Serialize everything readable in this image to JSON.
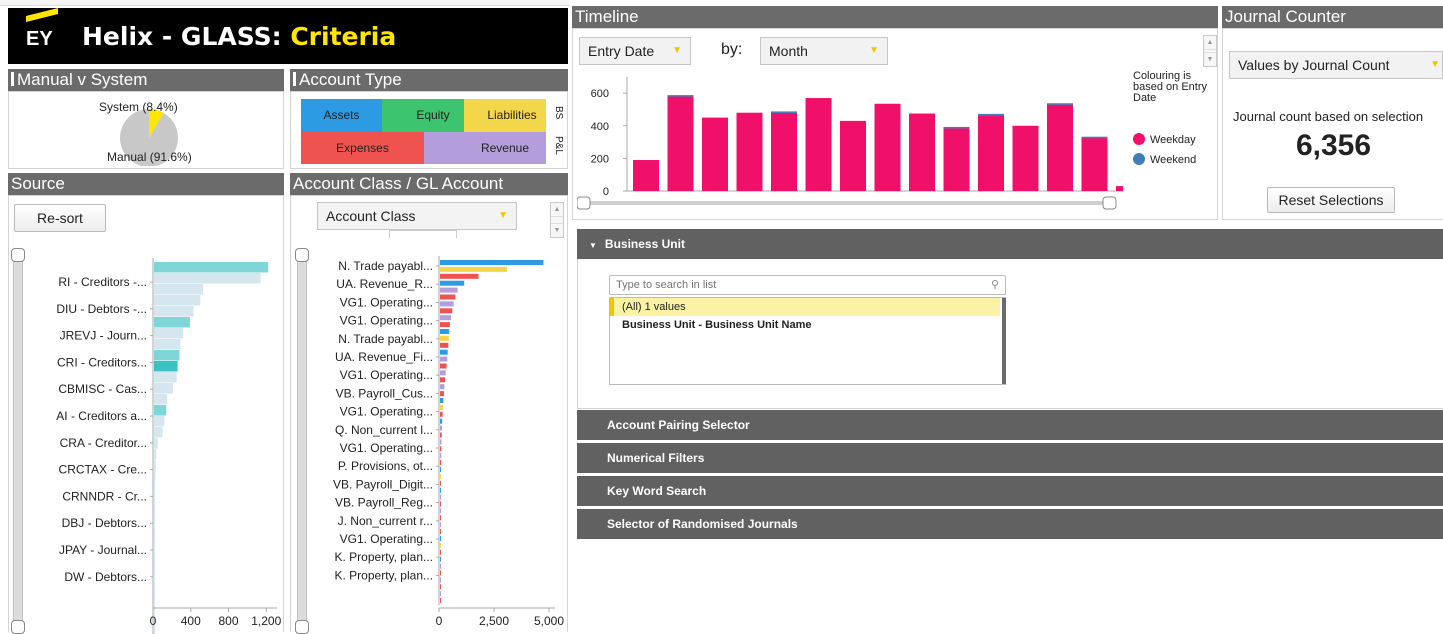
{
  "banner": {
    "brand": "EY",
    "title_prefix": "Helix - GLASS:",
    "title_highlight": "Criteria"
  },
  "manual_v_system": {
    "header": "Manual v System",
    "system_label": "System (8.4%)",
    "manual_label": "Manual (91.6%)",
    "slices": [
      {
        "name": "Manual",
        "value": 91.6,
        "color": "#c8c8c8"
      },
      {
        "name": "System",
        "value": 8.4,
        "color": "#ffe600"
      }
    ]
  },
  "account_type": {
    "header": "Account Type",
    "tiles": [
      {
        "label": "Assets",
        "color": "#2c9be4"
      },
      {
        "label": "Equity",
        "color": "#3dc46f"
      },
      {
        "label": "Liabilities",
        "color": "#f4d64a"
      },
      {
        "label": "Expenses",
        "color": "#ef5350"
      },
      {
        "label": "Revenue",
        "color": "#b39ddb"
      }
    ],
    "side_labels": [
      "BS",
      "P&L"
    ]
  },
  "source": {
    "header": "Source",
    "resort_label": "Re-sort",
    "chart_data": {
      "type": "bar",
      "orientation": "horizontal",
      "categories": [
        "RI - Creditors -...",
        "DIU - Debtors -...",
        "JREVJ - Journ...",
        "CRI - Creditors...",
        "CBMISC - Cas...",
        "AI - Creditors a...",
        "CRA - Creditor...",
        "CRCTAX - Cre...",
        "CRNNDR - Cr...",
        "DBJ - Debtors...",
        "JPAY - Journal...",
        "DW - Debtors..."
      ],
      "values": [
        1210,
        1130,
        520,
        490,
        420,
        380,
        310,
        280,
        270,
        250,
        240,
        200,
        140,
        130,
        110,
        90,
        40,
        25,
        20,
        15,
        12,
        10,
        8,
        7,
        6,
        5,
        5,
        4,
        3,
        3,
        2,
        2,
        2,
        1,
        1
      ],
      "xticks": [
        "0",
        "400",
        "800",
        "1,200"
      ],
      "xlim": [
        0,
        1250
      ]
    }
  },
  "account_class": {
    "header": "Account Class / GL Account",
    "selector_value": "Account Class",
    "chart_data": {
      "type": "bar",
      "orientation": "horizontal",
      "categories": [
        "N. Trade payabl...",
        "UA. Revenue_R...",
        "VG1. Operating...",
        "VG1. Operating...",
        "N. Trade payabl...",
        "UA. Revenue_Fi...",
        "VG1. Operating...",
        "VB. Payroll_Cus...",
        "VG1. Operating...",
        "Q. Non_current l...",
        "VG1. Operating...",
        "P. Provisions, ot...",
        "VB. Payroll_Digit...",
        "VB. Payroll_Reg...",
        "J. Non_current r...",
        "VG1. Operating...",
        "K. Property, plan...",
        "K. Property, plan..."
      ],
      "values": [
        4700,
        3050,
        1750,
        1100,
        800,
        700,
        620,
        560,
        500,
        450,
        420,
        400,
        380,
        350,
        330,
        300,
        260,
        230,
        200,
        180,
        150,
        140,
        120,
        100,
        90,
        80,
        70,
        60,
        55,
        50,
        45,
        40,
        35,
        30,
        30,
        25,
        25,
        20,
        20,
        15,
        15,
        10,
        10,
        10,
        8,
        6,
        5,
        5,
        4,
        3
      ],
      "xticks": [
        "0",
        "2,500",
        "5,000"
      ],
      "xlim": [
        0,
        5000
      ]
    }
  },
  "timeline": {
    "header": "Timeline",
    "field_value": "Entry Date",
    "by_label": "by:",
    "period_value": "Month",
    "legend_note": "Colouring is based on Entry Date",
    "chart_data": {
      "type": "bar",
      "stacked": true,
      "series": [
        {
          "name": "Weekday",
          "color": "#f0106a",
          "values": [
            190,
            580,
            450,
            480,
            480,
            570,
            430,
            535,
            475,
            385,
            465,
            400,
            530,
            325,
            30
          ]
        },
        {
          "name": "Weekend",
          "color": "#3e7fb8",
          "values": [
            0,
            8,
            0,
            0,
            8,
            0,
            0,
            0,
            0,
            8,
            8,
            0,
            8,
            8,
            0
          ]
        }
      ],
      "yticks": [
        "0",
        "200",
        "400",
        "600"
      ],
      "ylim": [
        0,
        650
      ]
    }
  },
  "journal_counter": {
    "header": "Journal Counter",
    "selector_value": "Values by Journal Count",
    "caption": "Journal count based on selection",
    "count": "6,356",
    "reset_label": "Reset Selections"
  },
  "business_unit": {
    "title": "Business Unit",
    "search_placeholder": "Type to search in list",
    "items": [
      "(All) 1 values",
      "Business Unit - Business Unit Name"
    ]
  },
  "collapsed_sections": [
    "Account Pairing Selector",
    "Numerical Filters",
    "Key Word Search",
    "Selector of Randomised Journals"
  ]
}
